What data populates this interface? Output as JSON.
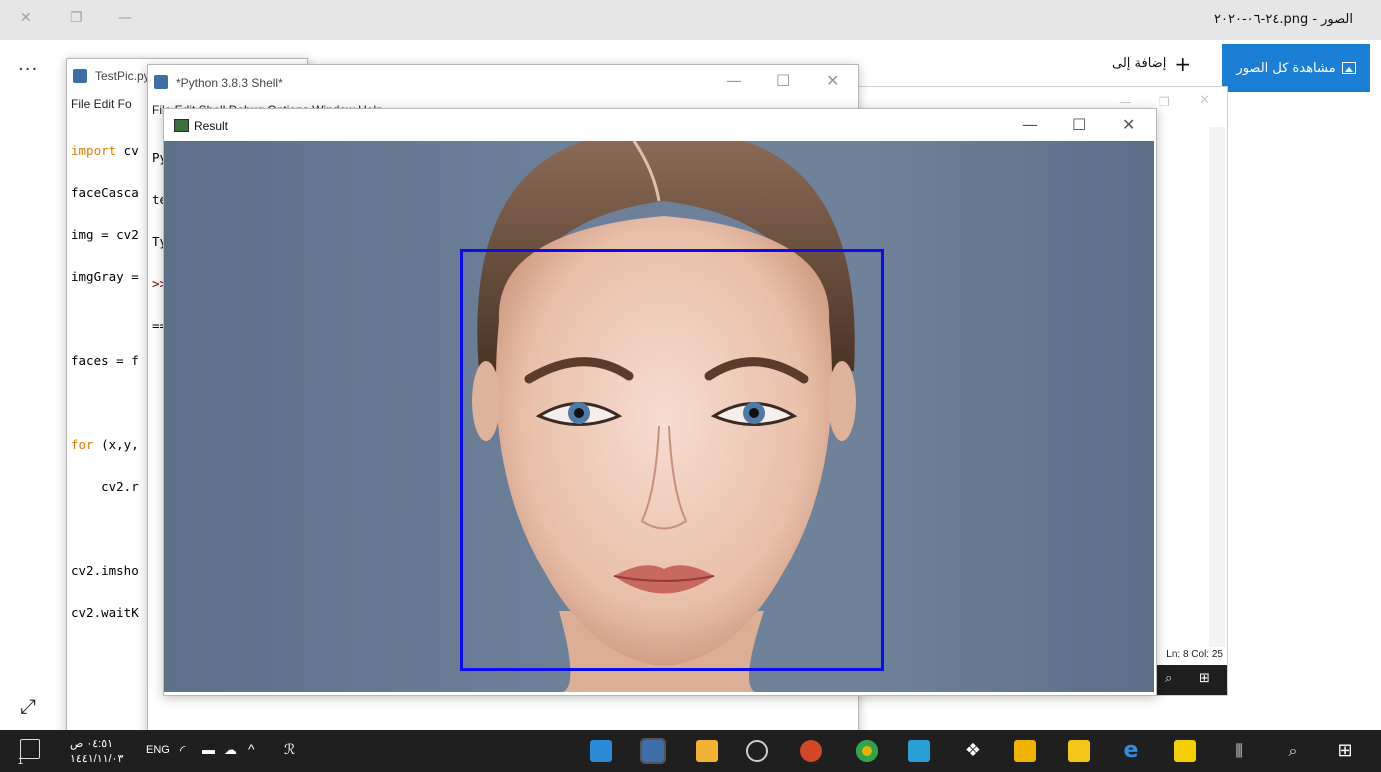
{
  "photos": {
    "title": "الصور - png.٢٤-٠٦-٢٠٢٠",
    "see_all_label": "مشاهدة كل الصور",
    "add_to_label": "إضافة إلى",
    "more_label": "...",
    "status_ln_col": "Ln: 8  Col: 25"
  },
  "editor": {
    "title": "TestPic.py",
    "menu": "File  Edit  Fo",
    "code_lines": [
      "import cv",
      "faceCasca",
      "img = cv2",
      "imgGray =",
      "",
      "faces = f",
      "",
      "for (x,y,",
      "    cv2.r",
      "",
      "cv2.imsho",
      "cv2.waitK"
    ]
  },
  "shell": {
    "title": "*Python 3.8.3 Shell*",
    "menu": "File  Edit  Shell  Debug  Options  Window  Help",
    "lines": [
      "Py",
      "te",
      "Ty",
      ">>",
      "=="
    ]
  },
  "result": {
    "title": "Result",
    "face_box": "detected-face"
  },
  "taskbar": {
    "time": "٠٤:٥١ ص",
    "date": "١٤٤١/١١/٠٣",
    "language": "ENG",
    "notification_count": "1"
  },
  "colors": {
    "accent": "#1c7fd6",
    "face_box": "#0c0cf0",
    "taskbar": "#1f1f1f"
  }
}
